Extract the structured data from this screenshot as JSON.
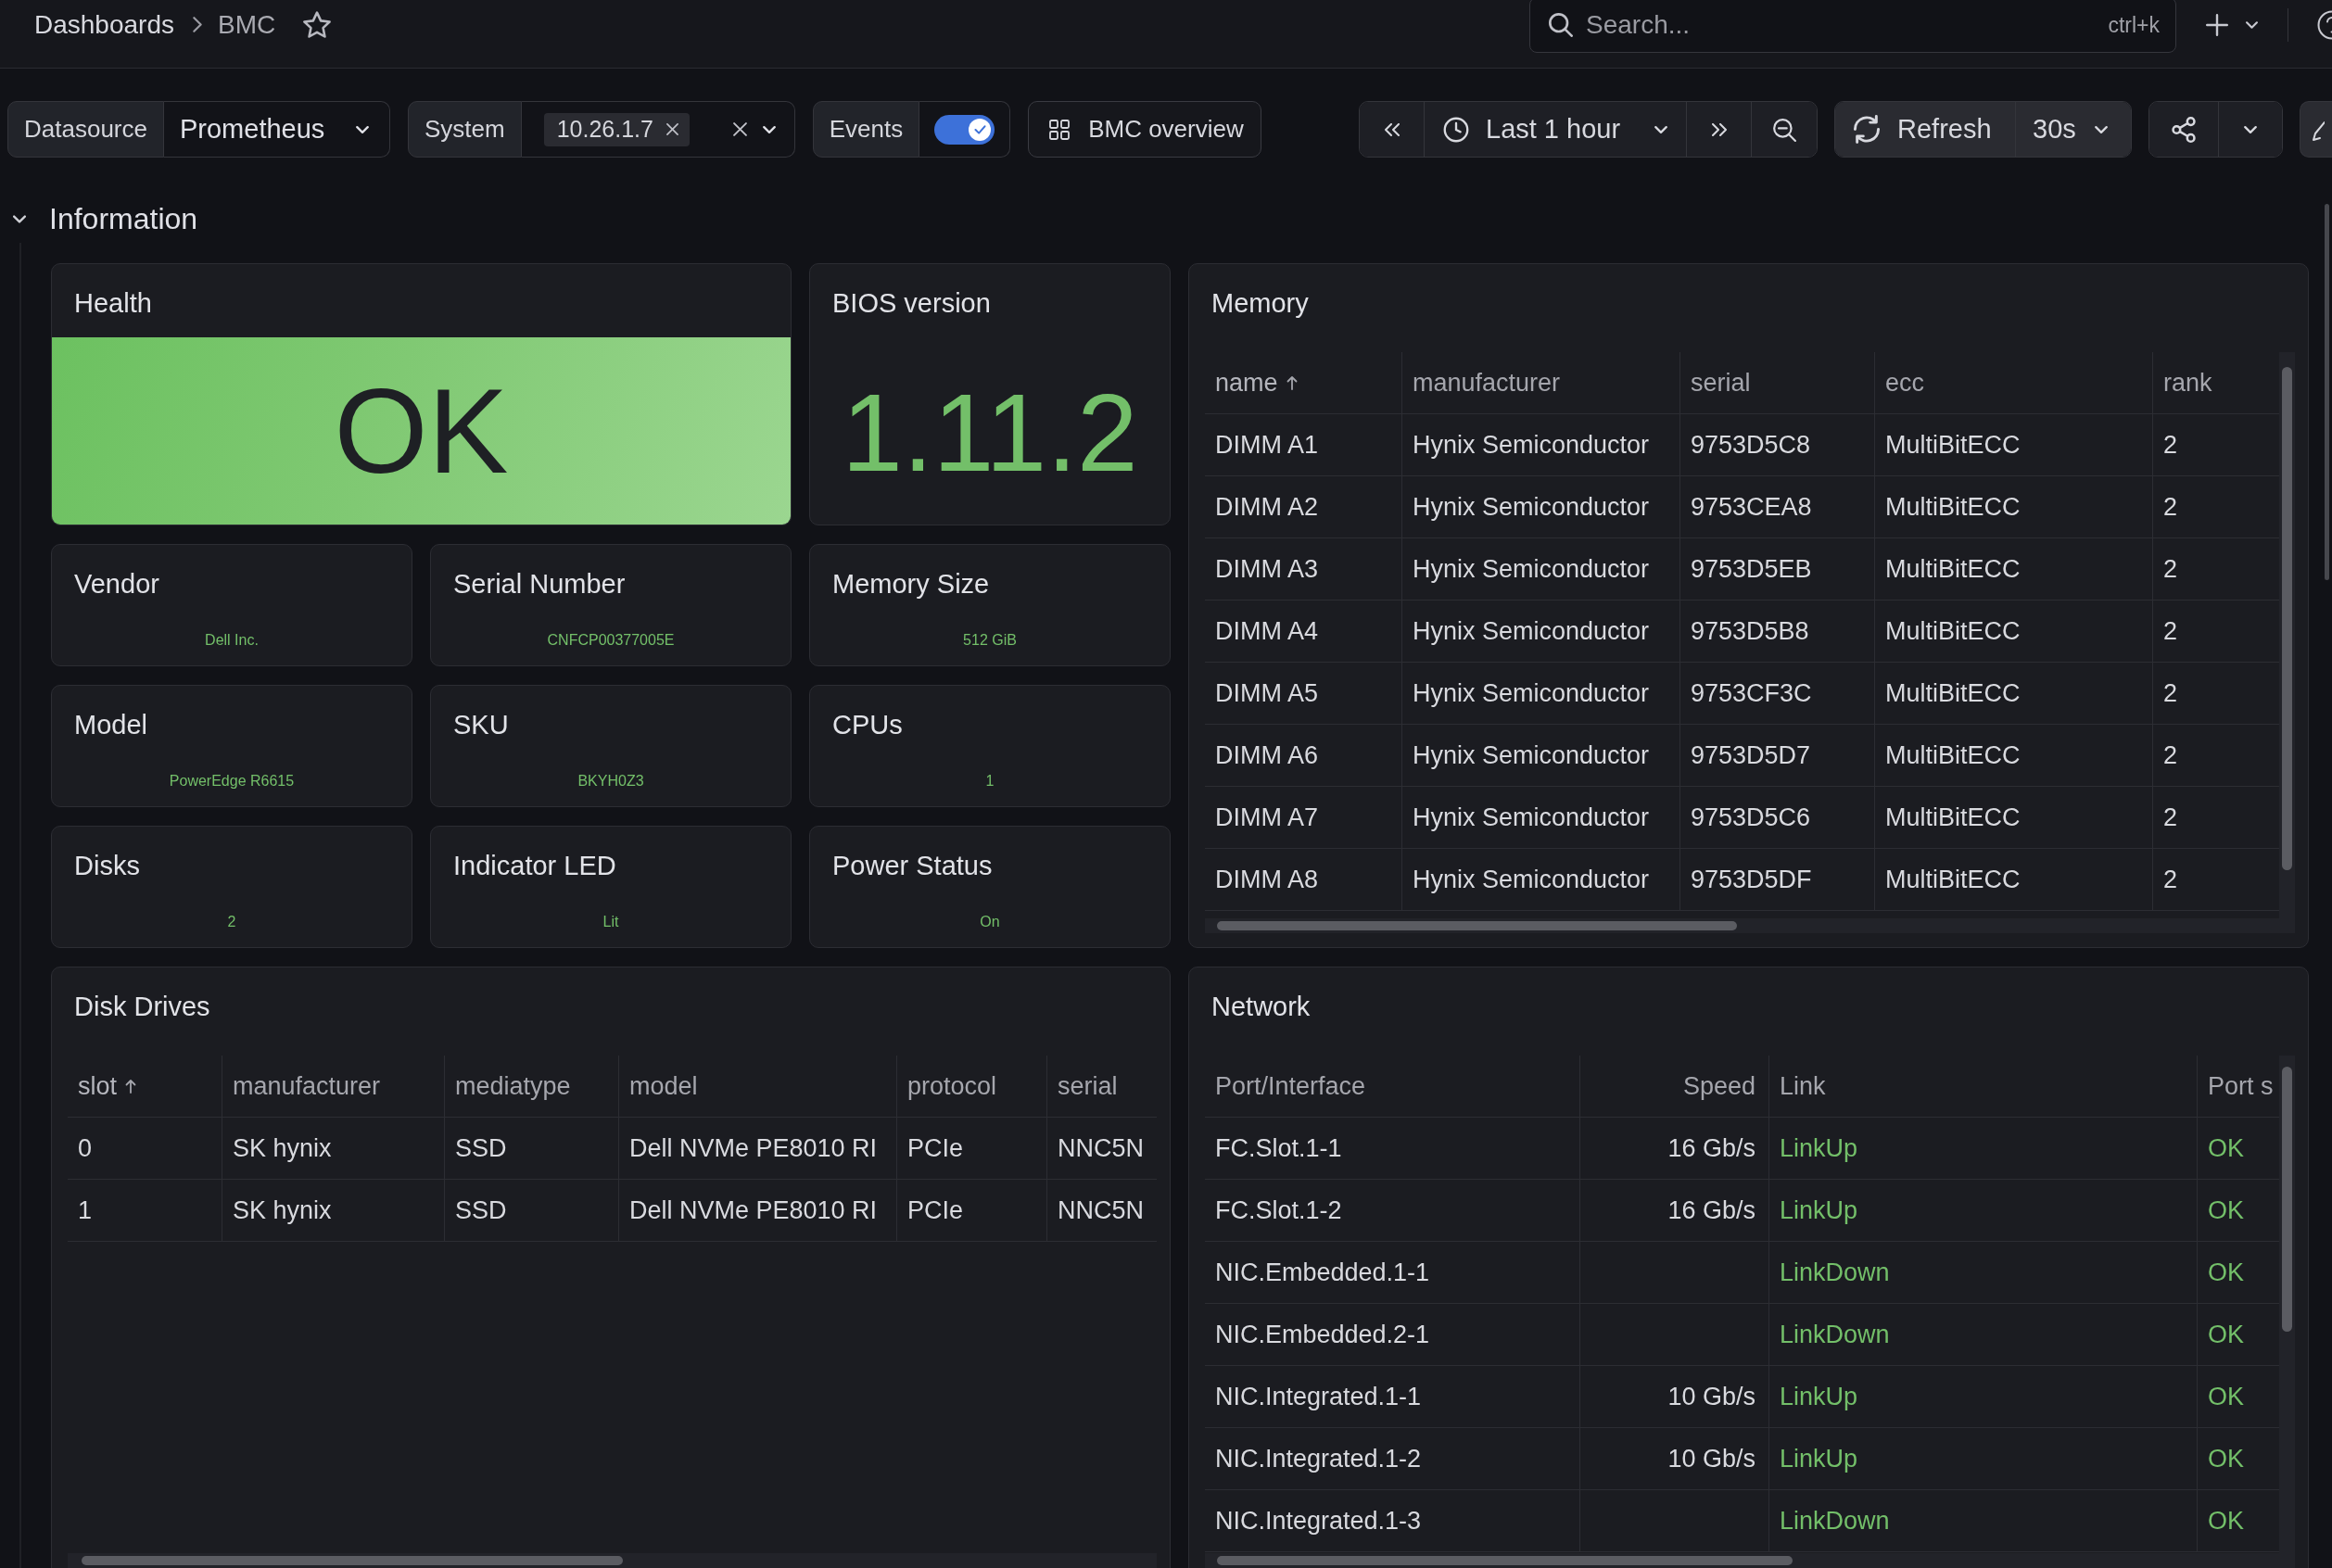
{
  "top_bar": {
    "breadcrumbs": [
      "Dashboards",
      "BMC"
    ],
    "starred": false,
    "search": {
      "placeholder": "Search...",
      "shortcut": "ctrl+k"
    }
  },
  "variables": [
    {
      "kind": "select",
      "label": "Datasource",
      "value": "Prometheus"
    },
    {
      "kind": "multi_select",
      "label": "System",
      "chips": [
        "10.26.1.7"
      ]
    },
    {
      "kind": "toggle",
      "label": "Events",
      "on": true
    }
  ],
  "dashboard_links": [
    {
      "label": "BMC overview"
    }
  ],
  "time_picker": {
    "range": "Last 1 hour"
  },
  "refresh": {
    "label": "Refresh",
    "interval": "30s"
  },
  "row": {
    "title": "Information",
    "expanded": true
  },
  "stats": [
    {
      "kind": "color_background",
      "title": "Health",
      "value": "OK"
    },
    {
      "kind": "big_value",
      "title": "BIOS version",
      "value": "1.11.2"
    },
    {
      "kind": "value",
      "title": "Vendor",
      "value": "Dell Inc."
    },
    {
      "kind": "value",
      "title": "Serial Number",
      "value": "CNFCP00377005E"
    },
    {
      "kind": "value",
      "title": "Memory Size",
      "value": "512 GiB"
    },
    {
      "kind": "value",
      "title": "Model",
      "value": "PowerEdge R6615"
    },
    {
      "kind": "value",
      "title": "SKU",
      "value": "BKYH0Z3"
    },
    {
      "kind": "value",
      "title": "CPUs",
      "value": "1"
    },
    {
      "kind": "value",
      "title": "Disks",
      "value": "2"
    },
    {
      "kind": "value",
      "title": "Indicator LED",
      "value": "Lit"
    },
    {
      "kind": "value",
      "title": "Power Status",
      "value": "On"
    }
  ],
  "memory": {
    "title": "Memory",
    "columns": [
      {
        "label": "name",
        "sorted": true
      },
      {
        "label": "manufacturer",
        "sorted": false
      },
      {
        "label": "serial",
        "sorted": false
      },
      {
        "label": "ecc",
        "sorted": false
      },
      {
        "label": "rank",
        "sorted": false
      }
    ],
    "rows": [
      [
        "DIMM A1",
        "Hynix Semiconductor",
        "9753D5C8",
        "MultiBitECC",
        "2"
      ],
      [
        "DIMM A2",
        "Hynix Semiconductor",
        "9753CEA8",
        "MultiBitECC",
        "2"
      ],
      [
        "DIMM A3",
        "Hynix Semiconductor",
        "9753D5EB",
        "MultiBitECC",
        "2"
      ],
      [
        "DIMM A4",
        "Hynix Semiconductor",
        "9753D5B8",
        "MultiBitECC",
        "2"
      ],
      [
        "DIMM A5",
        "Hynix Semiconductor",
        "9753CF3C",
        "MultiBitECC",
        "2"
      ],
      [
        "DIMM A6",
        "Hynix Semiconductor",
        "9753D5D7",
        "MultiBitECC",
        "2"
      ],
      [
        "DIMM A7",
        "Hynix Semiconductor",
        "9753D5C6",
        "MultiBitECC",
        "2"
      ],
      [
        "DIMM A8",
        "Hynix Semiconductor",
        "9753D5DF",
        "MultiBitECC",
        "2"
      ]
    ]
  },
  "disk_drives": {
    "title": "Disk Drives",
    "columns": [
      {
        "label": "slot",
        "sorted": true
      },
      {
        "label": "manufacturer",
        "sorted": false
      },
      {
        "label": "mediatype",
        "sorted": false
      },
      {
        "label": "model",
        "sorted": false
      },
      {
        "label": "protocol",
        "sorted": false
      },
      {
        "label": "serial",
        "sorted": false
      }
    ],
    "rows": [
      [
        "0",
        "SK hynix",
        "SSD",
        "Dell NVMe PE8010 RI",
        "PCIe",
        "NNC5N"
      ],
      [
        "1",
        "SK hynix",
        "SSD",
        "Dell NVMe PE8010 RI",
        "PCIe",
        "NNC5N"
      ]
    ]
  },
  "network": {
    "title": "Network",
    "columns": [
      {
        "label": "Port/Interface",
        "kind": "text",
        "sorted": false
      },
      {
        "label": "Speed",
        "kind": "number",
        "sorted": false
      },
      {
        "label": "Link",
        "kind": "status",
        "sorted": false
      },
      {
        "label": "Port s",
        "kind": "status",
        "sorted": false
      }
    ],
    "rows": [
      [
        "FC.Slot.1-1",
        "16 Gb/s",
        "LinkUp",
        "OK"
      ],
      [
        "FC.Slot.1-2",
        "16 Gb/s",
        "LinkUp",
        "OK"
      ],
      [
        "NIC.Embedded.1-1",
        null,
        "LinkDown",
        "OK"
      ],
      [
        "NIC.Embedded.2-1",
        null,
        "LinkDown",
        "OK"
      ],
      [
        "NIC.Integrated.1-1",
        "10 Gb/s",
        "LinkUp",
        "OK"
      ],
      [
        "NIC.Integrated.1-2",
        "10 Gb/s",
        "LinkUp",
        "OK"
      ],
      [
        "NIC.Integrated.1-3",
        null,
        "LinkDown",
        "OK"
      ]
    ]
  }
}
